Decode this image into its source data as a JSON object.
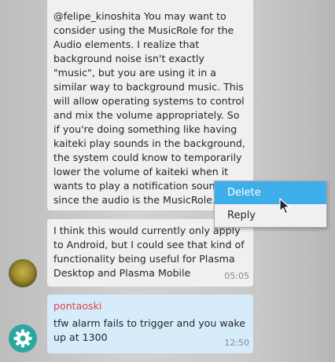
{
  "messages": [
    {
      "text": "@felipe_kinoshita You may want to consider using the MusicRole for the Audio elements. I realize that background noise isn't exactly \"music\", but you are using it in a similar way to background music. This will allow operating systems to control and mix the volume appropriately. So if you're doing something like having kaiteki play sounds in the background, the system could know to temporarily lower the volume of kaiteki when it wants to play a notification sound since the audio is the MusicRole."
    },
    {
      "text": "I think this would currently only apply to Android, but I could see that kind of functionality being useful for Plasma Desktop and Plasma Mobile",
      "time": "05:05"
    },
    {
      "sender": "pontaoski",
      "text": "tfw alarm fails to trigger and you wake up at 1300",
      "time": "12:50"
    }
  ],
  "context_menu": {
    "items": [
      "Delete",
      "Reply"
    ],
    "active_index": 0
  },
  "colors": {
    "accent": "#3daee9",
    "sender": "#da4453",
    "own_bubble": "#d6ecfb"
  },
  "icons": {
    "avatar_2": "gear-icon"
  }
}
